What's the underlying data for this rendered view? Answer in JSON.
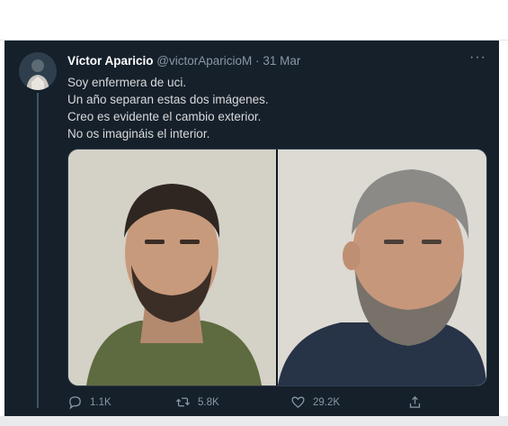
{
  "tweet": {
    "author_name": "Víctor Aparicio",
    "handle": "@victorAparicioM",
    "separator": "·",
    "date": "31 Mar",
    "more_label": "···",
    "lines": [
      "Soy enfermera de uci.",
      "Un año separan estas dos imágenes.",
      "Creo es evidente el cambio exterior.",
      "No os imagináis el interior."
    ]
  },
  "actions": {
    "reply_count": "1.1K",
    "retweet_count": "5.8K",
    "like_count": "29.2K"
  },
  "colors": {
    "background": "#15202b",
    "text": "#d9d9d9",
    "muted": "#8899a6"
  }
}
